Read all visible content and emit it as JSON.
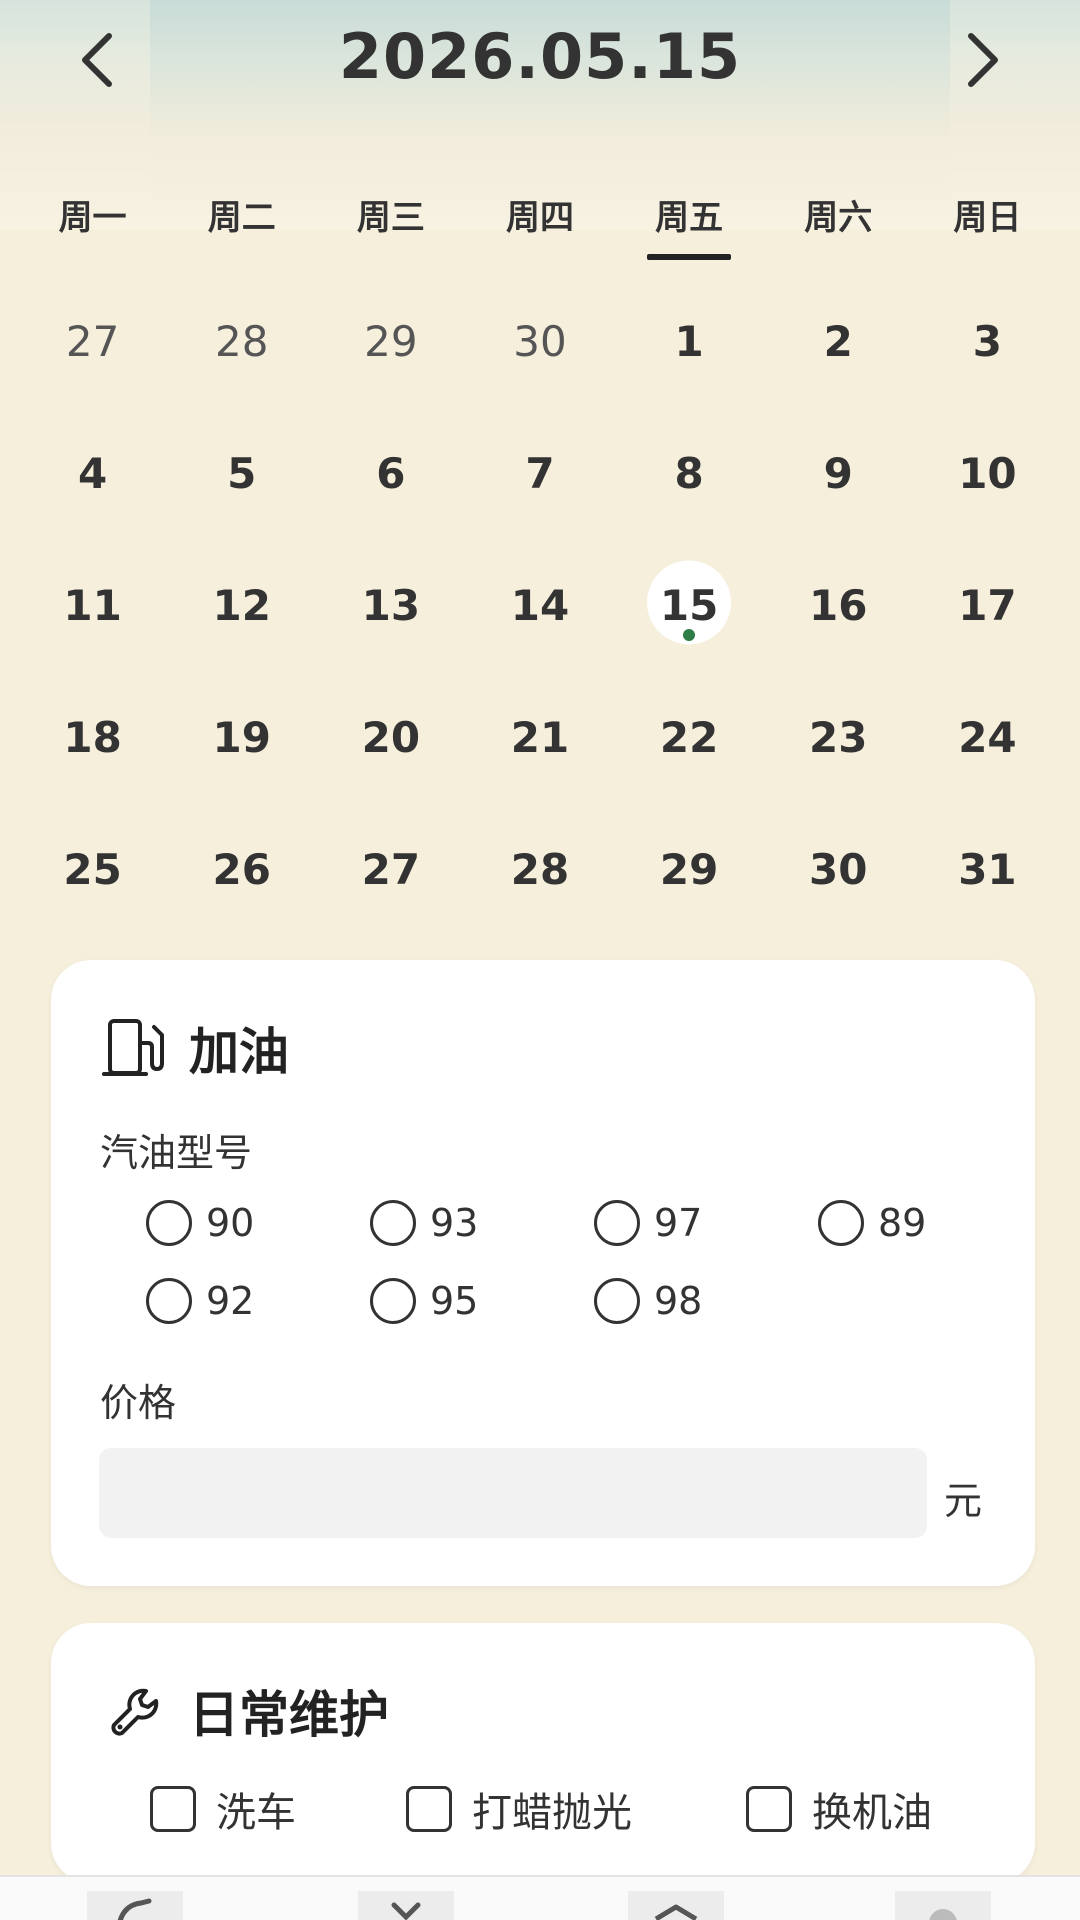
{
  "header": {
    "date": "2026.05.15"
  },
  "weekdays": [
    "周一",
    "周二",
    "周三",
    "周四",
    "周五",
    "周六",
    "周日"
  ],
  "calendar": {
    "rows": [
      [
        "27",
        "28",
        "29",
        "30",
        "1",
        "2",
        "3"
      ],
      [
        "4",
        "5",
        "6",
        "7",
        "8",
        "9",
        "10"
      ],
      [
        "11",
        "12",
        "13",
        "14",
        "15",
        "16",
        "17"
      ],
      [
        "18",
        "19",
        "20",
        "21",
        "22",
        "23",
        "24"
      ],
      [
        "25",
        "26",
        "27",
        "28",
        "29",
        "30",
        "31"
      ]
    ],
    "selected": "15",
    "selected_weekday_index": 4
  },
  "fuel": {
    "title": "加油",
    "type_label": "汽油型号",
    "options_row1": [
      "90",
      "93",
      "97",
      "89"
    ],
    "options_row2": [
      "92",
      "95",
      "98"
    ],
    "price_label": "价格",
    "price_value": "",
    "unit": "元"
  },
  "maintenance": {
    "title": "日常维护",
    "options": [
      "洗车",
      "打蜡抛光",
      "换机油"
    ]
  },
  "colors": {
    "background": "#f6efdc",
    "card": "#ffffff",
    "dot": "#2e7d46",
    "input": "#f2f2f2"
  },
  "icons": {
    "prev": "chevron-left-icon",
    "next": "chevron-right-icon",
    "fuel": "fuel-pump-icon",
    "maintenance": "wrench-icon"
  }
}
